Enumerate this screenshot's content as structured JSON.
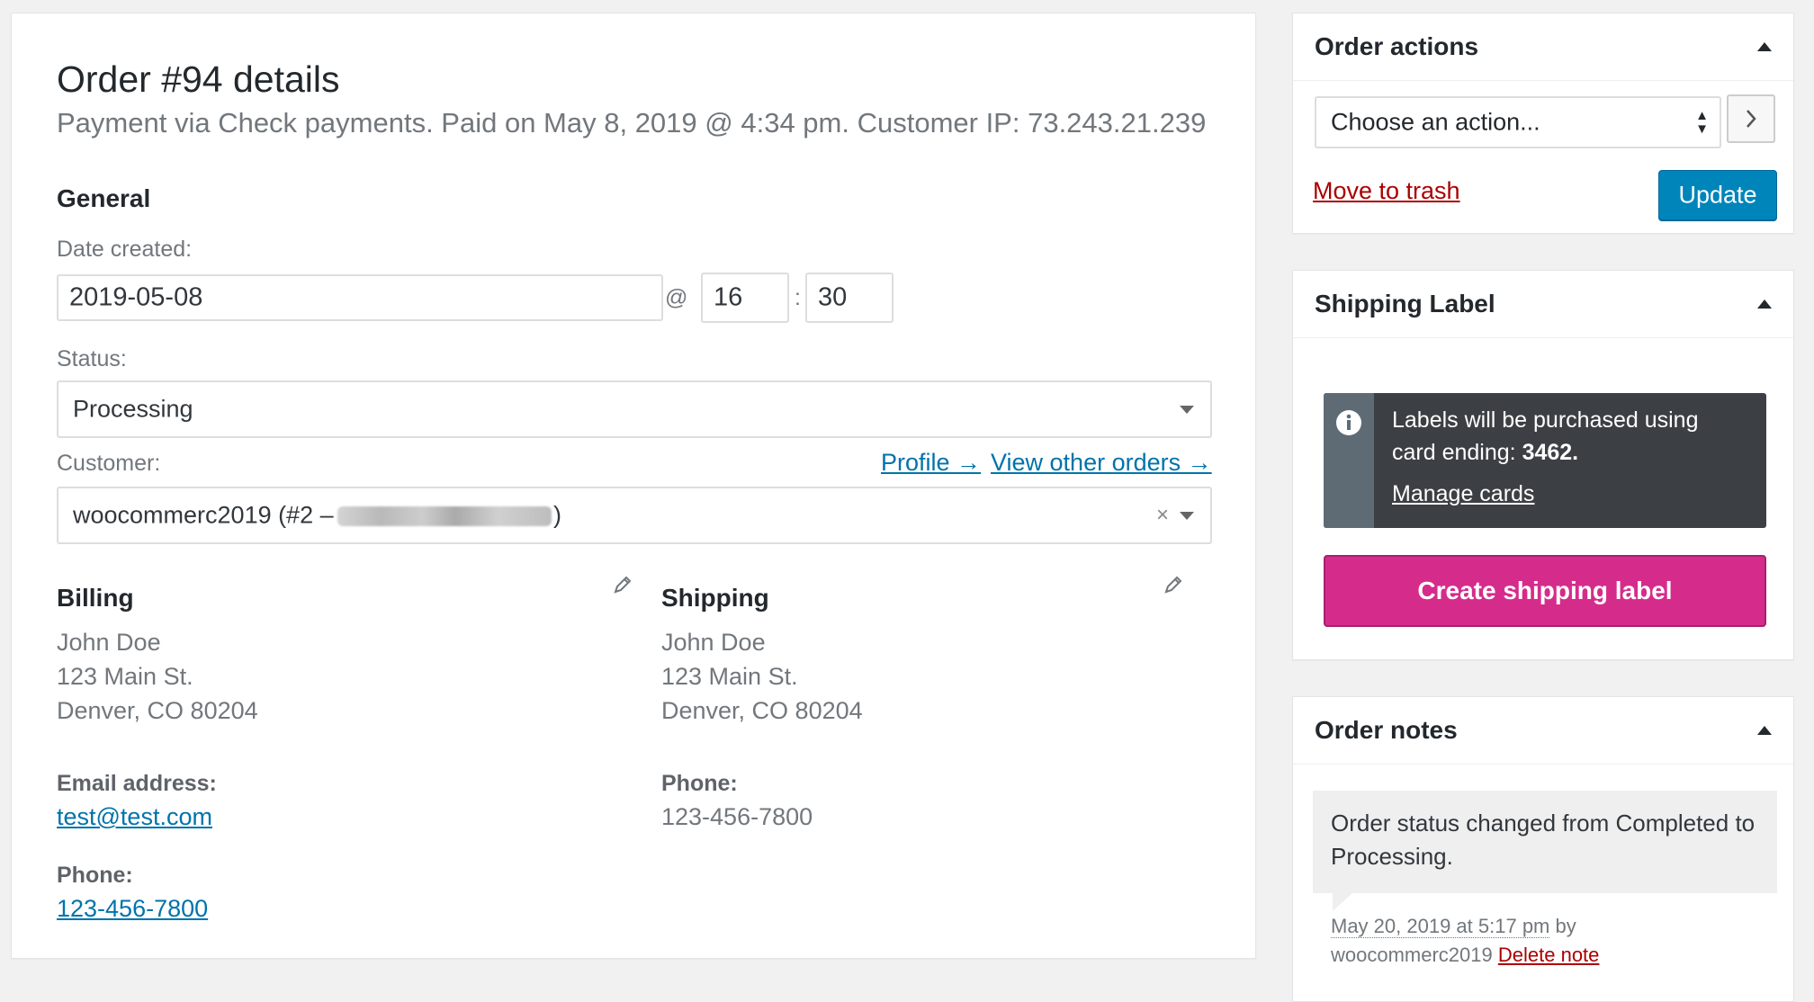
{
  "order": {
    "title": "Order #94 details",
    "subtitle": "Payment via Check payments. Paid on May 8, 2019 @ 4:34 pm. Customer IP: 73.243.21.239"
  },
  "general": {
    "heading": "General",
    "date_label": "Date created:",
    "date_value": "2019-05-08",
    "at_symbol": "@",
    "hour": "16",
    "colon": ":",
    "minute": "30",
    "status_label": "Status:",
    "status_value": "Processing",
    "customer_label": "Customer:",
    "profile_link": "Profile →",
    "view_orders_link": "View other orders →",
    "customer_value": "woocommerc2019 (#2 –",
    "customer_value_end": ")",
    "clear_symbol": "×"
  },
  "billing": {
    "heading": "Billing",
    "name": "John Doe",
    "street": "123 Main St.",
    "city": "Denver, CO 80204",
    "email_label": "Email address:",
    "email": "test@test.com",
    "phone_label": "Phone:",
    "phone": "123-456-7800"
  },
  "shipping": {
    "heading": "Shipping",
    "name": "John Doe",
    "street": "123 Main St.",
    "city": "Denver, CO 80204",
    "phone_label": "Phone:",
    "phone": "123-456-7800"
  },
  "order_actions": {
    "title": "Order actions",
    "select_value": "Choose an action...",
    "trash_link": "Move to trash",
    "update_button": "Update"
  },
  "shipping_label": {
    "title": "Shipping Label",
    "notice_text": "Labels will be purchased using",
    "notice_text2": "card ending:",
    "card_ending": "3462.",
    "manage_cards": "Manage cards",
    "create_button": "Create shipping label"
  },
  "order_notes": {
    "title": "Order notes",
    "note_text": "Order status changed from Completed to Processing.",
    "note_date": "May 20, 2019 at 5:17 pm",
    "by": "by",
    "author": "woocommerc2019",
    "delete_link": "Delete note"
  },
  "colors": {
    "link": "#0073aa",
    "trash": "#a00000",
    "update_button": "#0085ba",
    "create_label_button": "#d52c8c",
    "notice_bg": "#3c4044"
  },
  "icons": {
    "pencil": "pencil-icon",
    "info": "info-icon",
    "chevron": "chevron-right-icon"
  }
}
